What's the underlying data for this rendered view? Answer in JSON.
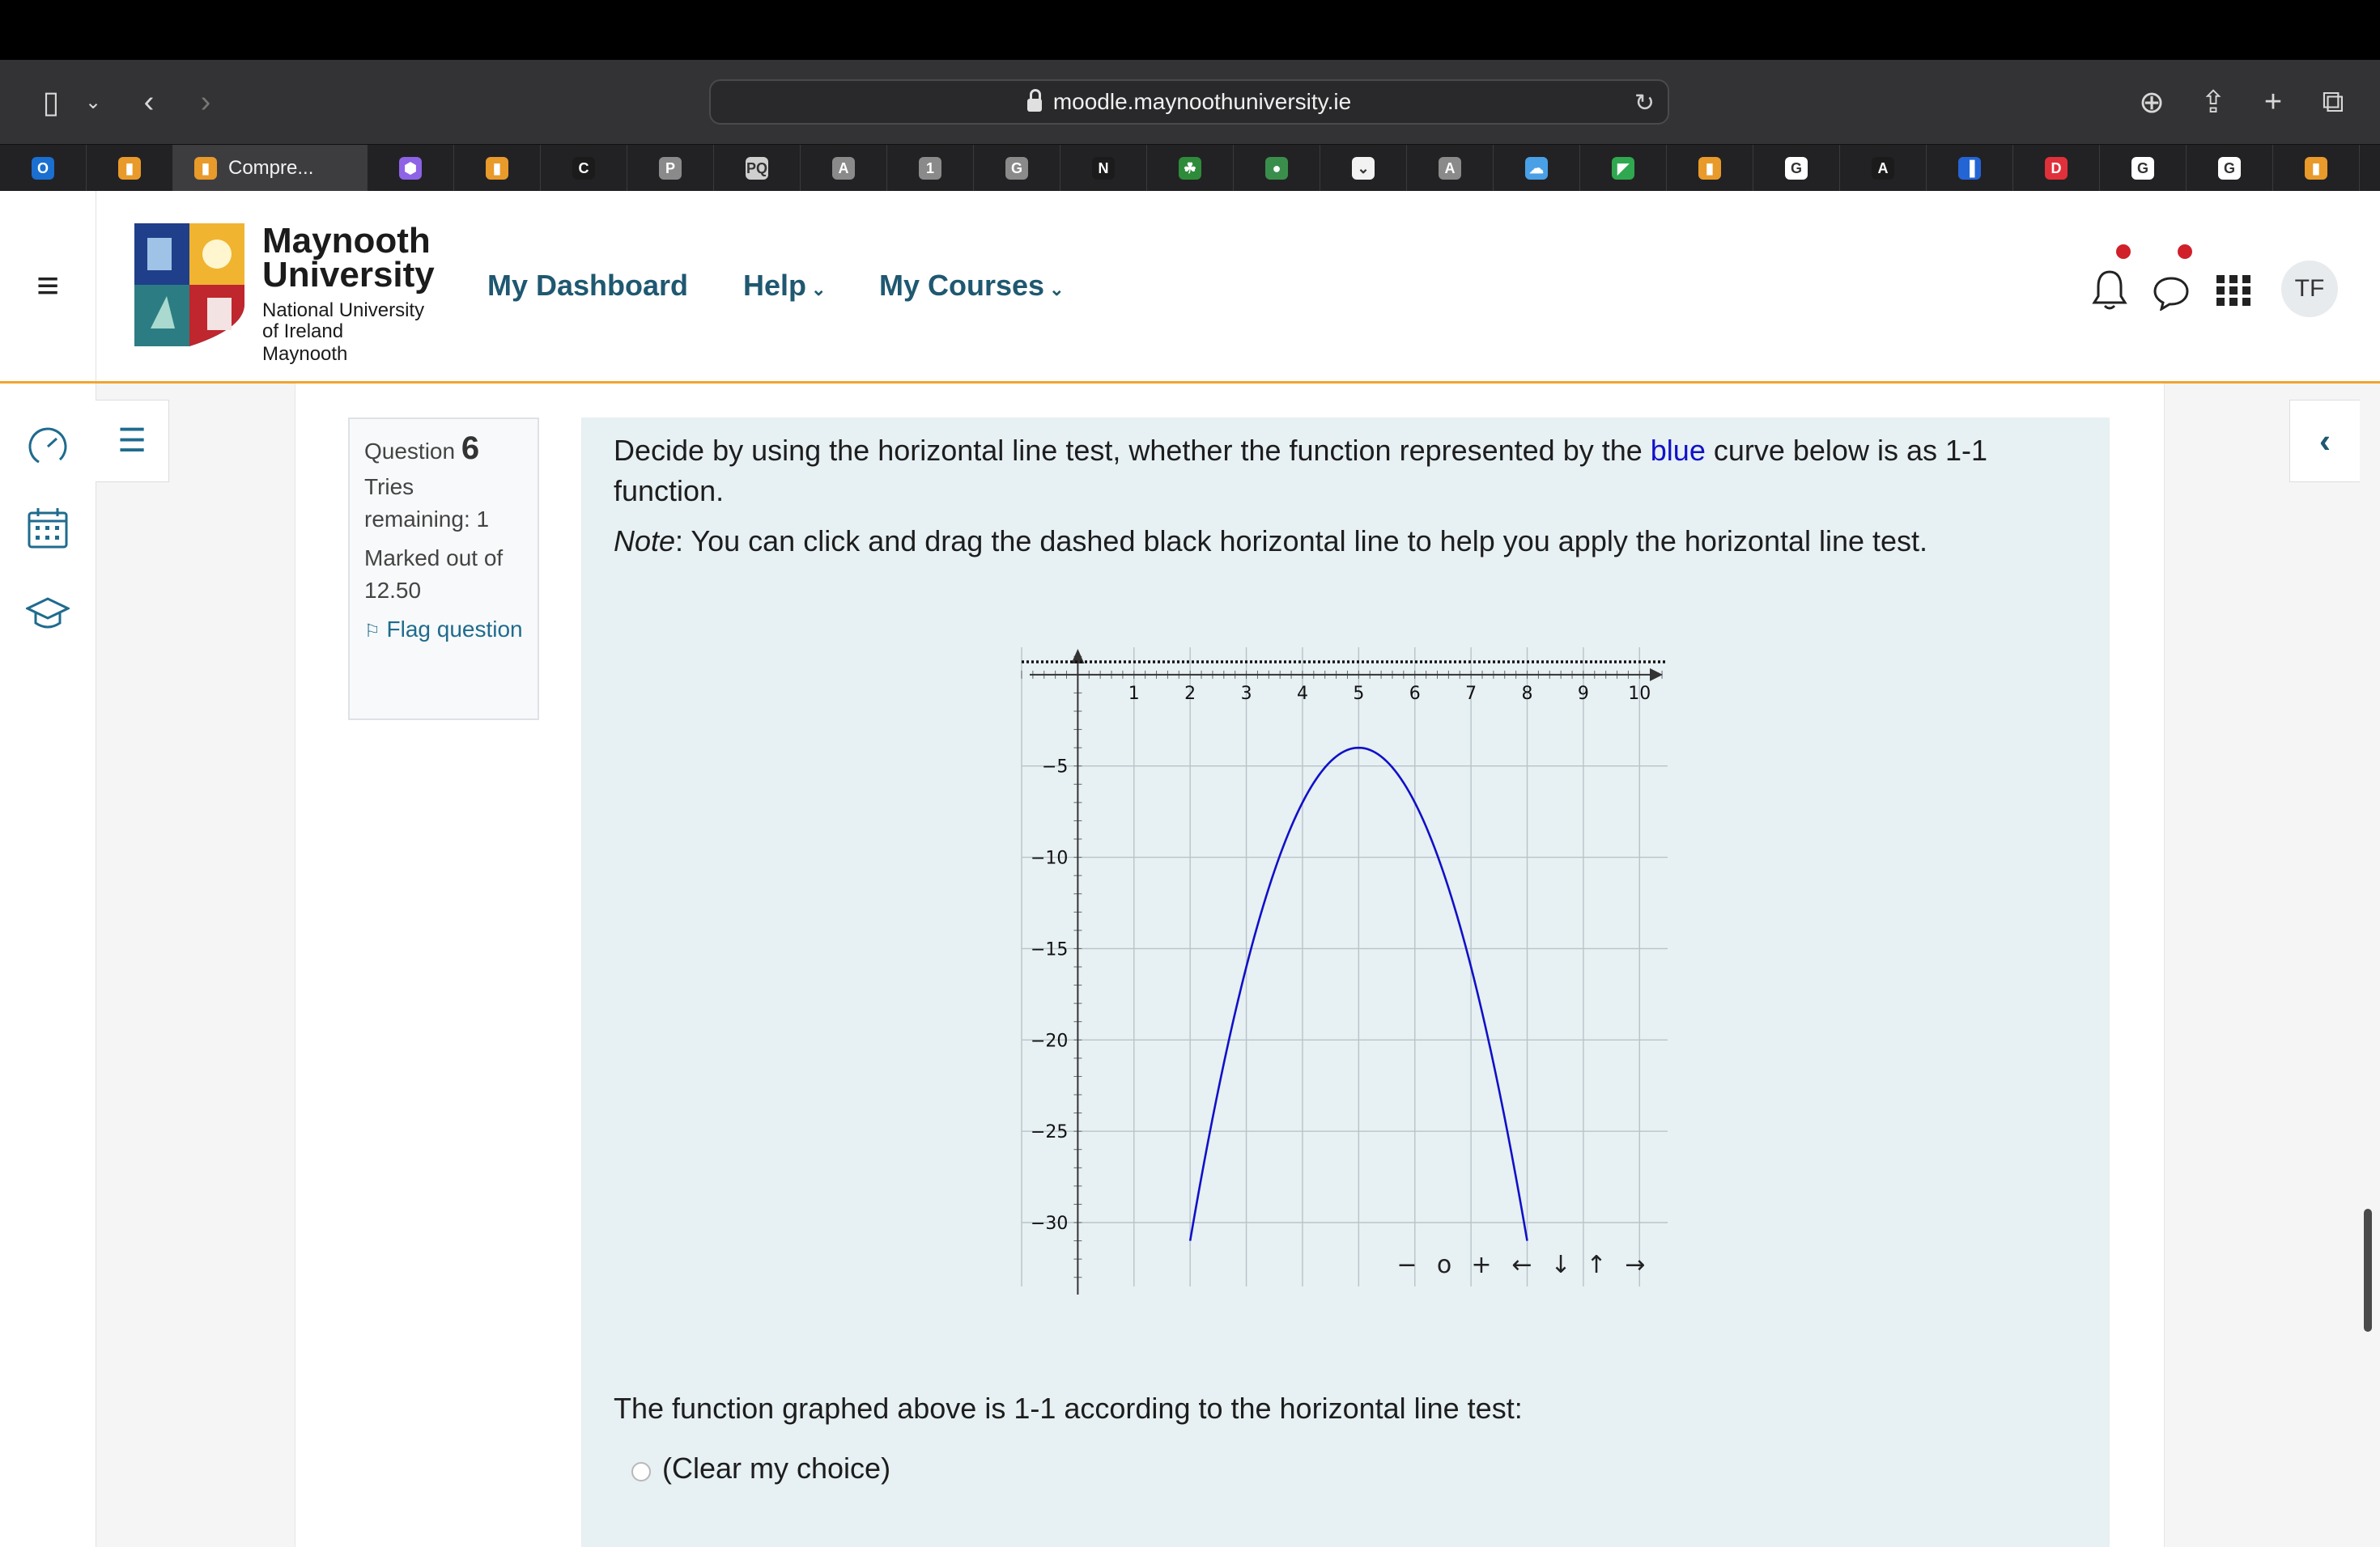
{
  "browser": {
    "url": "moodle.maynoothuniversity.ie",
    "active_tab_label": "Compre...",
    "tabs": [
      {
        "icon": "outlook-icon",
        "glyph": "O",
        "color": "#1a6fd1"
      },
      {
        "icon": "moodle-icon",
        "glyph": "▮",
        "color": "#e89a2a"
      },
      {
        "icon": "moodle-icon",
        "glyph": "▮",
        "color": "#e89a2a",
        "active": true
      },
      {
        "icon": "hexagon-icon",
        "glyph": "⬢",
        "color": "#8e63e6"
      },
      {
        "icon": "moodle-icon",
        "glyph": "▮",
        "color": "#e89a2a"
      },
      {
        "icon": "c-box-icon",
        "glyph": "C",
        "color": "#1b1b1b"
      },
      {
        "icon": "p-icon",
        "glyph": "P",
        "color": "#8a8a8a"
      },
      {
        "icon": "pq-icon",
        "glyph": "PQ",
        "color": "#cfcfcf"
      },
      {
        "icon": "a-icon",
        "glyph": "A",
        "color": "#8a8a8a"
      },
      {
        "icon": "one-icon",
        "glyph": "1",
        "color": "#8a8a8a"
      },
      {
        "icon": "g-icon",
        "glyph": "G",
        "color": "#8a8a8a"
      },
      {
        "icon": "notion-icon",
        "glyph": "N",
        "color": "#1b1b1b"
      },
      {
        "icon": "clover-icon",
        "glyph": "☘",
        "color": "#2e8b3a"
      },
      {
        "icon": "globe-icon",
        "glyph": "●",
        "color": "#3a8e4c"
      },
      {
        "icon": "pocket-icon",
        "glyph": "⌄",
        "color": "#f2f2f2"
      },
      {
        "icon": "a-icon",
        "glyph": "A",
        "color": "#8a8a8a"
      },
      {
        "icon": "cloud-icon",
        "glyph": "☁",
        "color": "#4aa0e6"
      },
      {
        "icon": "leaf-icon",
        "glyph": "◤",
        "color": "#2fa84f"
      },
      {
        "icon": "moodle-icon",
        "glyph": "▮",
        "color": "#e89a2a"
      },
      {
        "icon": "google-icon",
        "glyph": "G",
        "color": "#ffffff"
      },
      {
        "icon": "a-outline-icon",
        "glyph": "A",
        "color": "#1b1b1b"
      },
      {
        "icon": "book-icon",
        "glyph": "▐",
        "color": "#2465d6"
      },
      {
        "icon": "d-icon",
        "glyph": "D",
        "color": "#e0303a"
      },
      {
        "icon": "google-icon",
        "glyph": "G",
        "color": "#ffffff"
      },
      {
        "icon": "google-icon",
        "glyph": "G",
        "color": "#ffffff"
      },
      {
        "icon": "moodle-icon",
        "glyph": "▮",
        "color": "#e89a2a"
      }
    ]
  },
  "header": {
    "logo_line1": "Maynooth",
    "logo_line2": "University",
    "logo_sub1": "National University",
    "logo_sub2": "of Ireland Maynooth",
    "nav": {
      "dashboard": "My Dashboard",
      "help": "Help",
      "courses": "My Courses"
    },
    "avatar_initials": "TF"
  },
  "question": {
    "label": "Question",
    "number": "6",
    "tries": "Tries remaining: 1",
    "marked": "Marked out of 12.50",
    "flag": "Flag question",
    "text_before": "Decide by using the horizontal line test, whether the function represented by the ",
    "text_blue": "blue",
    "text_after": " curve below is as 1-1 function.",
    "note_label": "Note",
    "note_text": ": You can click and drag the dashed black horizontal line to help you apply the horizontal line test.",
    "answer_prompt": "The function graphed above is 1-1 according to the horizontal line test:",
    "clear_choice": "(Clear my choice)"
  },
  "chart_data": {
    "type": "line",
    "title": "",
    "xlabel": "",
    "ylabel": "",
    "x_ticks": [
      "1",
      "2",
      "3",
      "4",
      "5",
      "6",
      "7",
      "8",
      "9",
      "10"
    ],
    "y_ticks": [
      "−5",
      "−10",
      "−15",
      "−20",
      "−25",
      "−30"
    ],
    "xlim": [
      -1,
      10.5
    ],
    "ylim": [
      -33.5,
      1.5
    ],
    "grid": true,
    "series": [
      {
        "color": "#1010c8",
        "x": [
          2,
          2.5,
          3,
          3.5,
          4,
          4.5,
          5,
          5.5,
          6,
          6.5,
          7,
          7.5,
          8
        ],
        "y": [
          -31,
          -23.25,
          -16.5,
          -10.75,
          -7,
          -4.75,
          -4,
          -4.75,
          -7,
          -10.75,
          -16.5,
          -23.25,
          -31
        ]
      }
    ],
    "dashed_line_y": 0.7,
    "controls": [
      "−",
      "o",
      "+",
      "←",
      "↓",
      "↑",
      "→"
    ]
  }
}
